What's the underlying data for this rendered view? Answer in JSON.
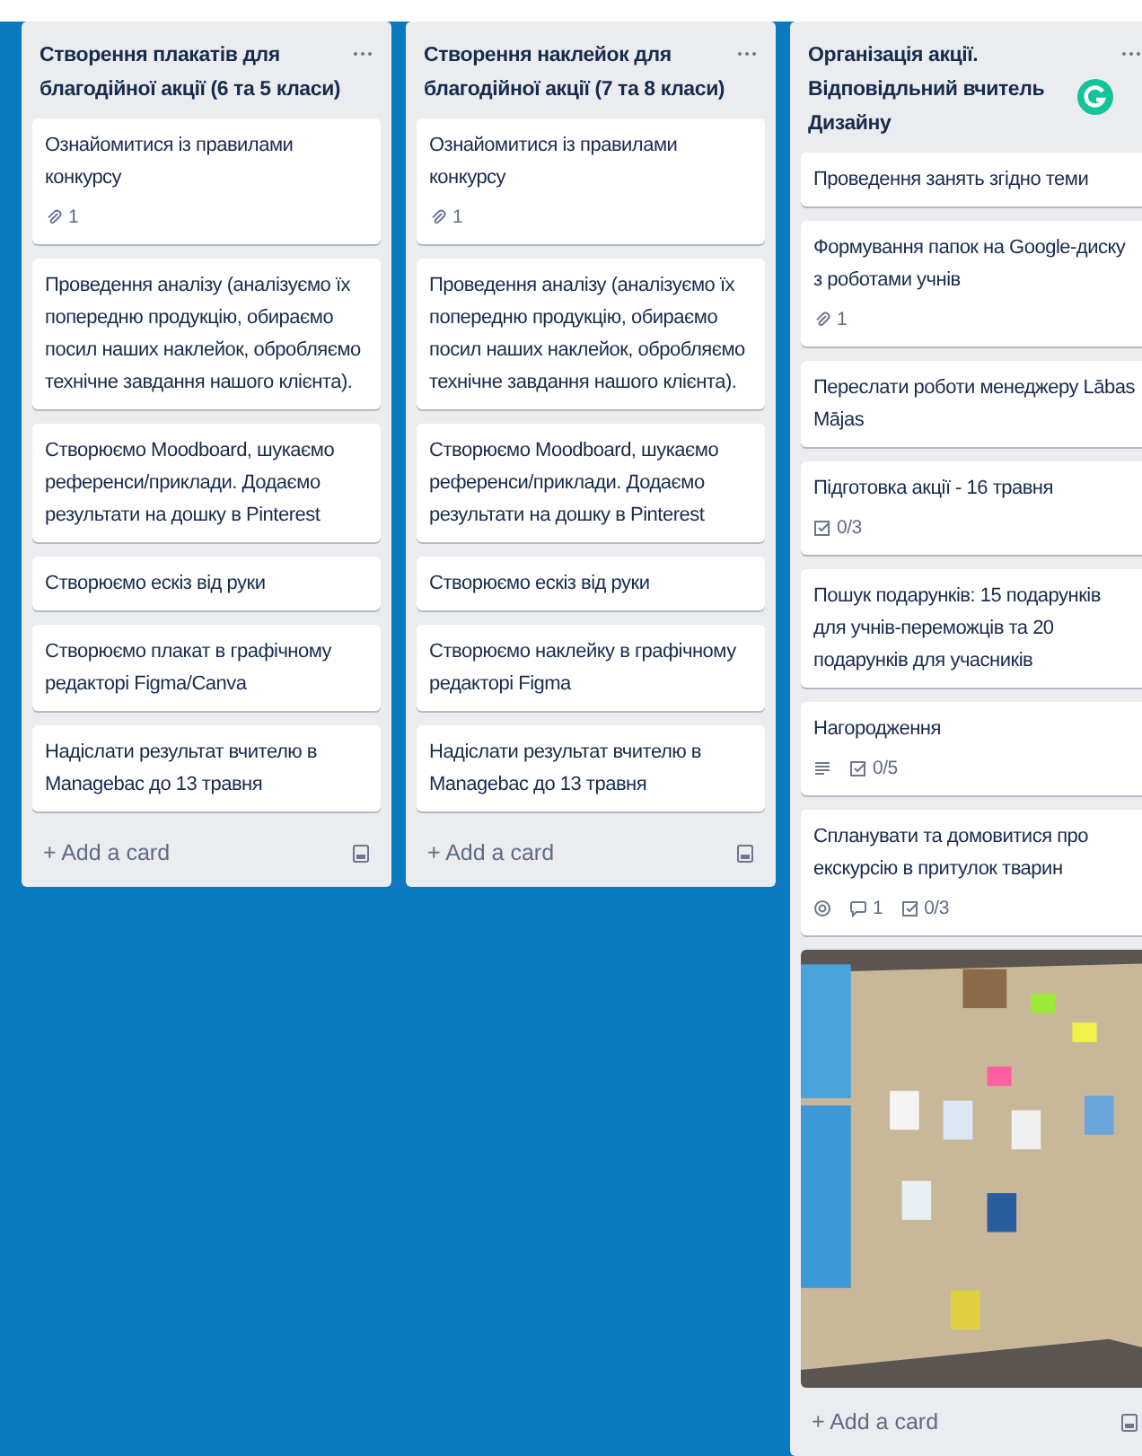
{
  "lists": [
    {
      "title": "Створення плакатів для благодійної акції (6 та 5 класи)",
      "cards": [
        {
          "text": "Ознайомитися із правилами конкурсу",
          "badges": [
            {
              "kind": "attachment",
              "count": "1"
            }
          ]
        },
        {
          "text": "Проведення аналізу (аналізуємо їх попередню продукцію, обираємо посил наших наклейок, обробляємо технічне завдання нашого клієнта)."
        },
        {
          "text": "Створюємо Moodboard, шукаємо референси/приклади. Додаємо результати на дошку в Pinterest"
        },
        {
          "text": "Створюємо ескіз від руки"
        },
        {
          "text": "Створюємо плакат в графічному редакторі Figma/Canva"
        },
        {
          "text": "Надіслати результат вчителю в Managebac до 13 травня"
        }
      ],
      "add_card": "+ Add a card"
    },
    {
      "title": "Створення наклейок для благодійної акції (7 та 8 класи)",
      "cards": [
        {
          "text": "Ознайомитися із правилами конкурсу",
          "badges": [
            {
              "kind": "attachment",
              "count": "1"
            }
          ]
        },
        {
          "text": "Проведення аналізу (аналізуємо їх попередню продукцію, обираємо посил наших наклейок, обробляємо технічне завдання нашого клієнта)."
        },
        {
          "text": "Створюємо Moodboard, шукаємо референси/приклади. Додаємо результати на дошку в Pinterest"
        },
        {
          "text": "Створюємо ескіз від руки"
        },
        {
          "text": "Створюємо наклейку в графічному редакторі Figma"
        },
        {
          "text": "Надіслати результат вчителю в Managebac до 13 травня"
        }
      ],
      "add_card": "+ Add a card"
    },
    {
      "title": "Організація акції. Відповідльний вчитель Дизайну",
      "grammar_badge": true,
      "cards": [
        {
          "text": "Проведення занять згідно теми"
        },
        {
          "text": "Формування папок на Google-диску з роботами учнів",
          "badges": [
            {
              "kind": "attachment",
              "count": "1"
            }
          ]
        },
        {
          "text": "Переслати роботи менеджеру Lābas Mājas"
        },
        {
          "text": "Підготовка акції - 16 травня",
          "badges": [
            {
              "kind": "checklist",
              "count": "0/3"
            }
          ]
        },
        {
          "text": "Пошук подарунків: 15 подарунків для учнів-переможців та 20 подарунків для учасників"
        },
        {
          "text": "Нагородження",
          "badges": [
            {
              "kind": "description"
            },
            {
              "kind": "checklist",
              "count": "0/5"
            }
          ]
        },
        {
          "text": "Спланувати та домовитися про екскурсію в притулок тварин",
          "badges": [
            {
              "kind": "watch"
            },
            {
              "kind": "comment",
              "count": "1"
            },
            {
              "kind": "checklist",
              "count": "0/3"
            }
          ]
        },
        {
          "kind": "picture"
        }
      ],
      "add_card": "+ Add a card"
    }
  ]
}
